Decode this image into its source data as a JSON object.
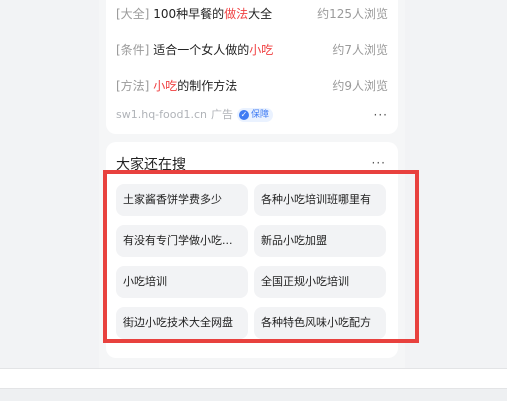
{
  "ad_card": {
    "rows": [
      {
        "tag": "[大全]",
        "pre": "100种早餐的",
        "highlight": "做法",
        "post": "大全",
        "views": "约125人浏览"
      },
      {
        "tag": "[条件]",
        "pre": "适合一个女人做的",
        "highlight": "小吃",
        "post": "",
        "views": "约7人浏览"
      },
      {
        "tag": "[方法]",
        "pre": "",
        "highlight": "小吃",
        "post": "的制作方法",
        "views": "约9人浏览"
      }
    ],
    "source_domain": "sw1.hq-food1.cn",
    "ad_label": "广告",
    "badge_label": "保障",
    "more_glyph": "···"
  },
  "people_search": {
    "title": "大家还在搜",
    "more_glyph": "···",
    "items": [
      "土家酱香饼学费多少",
      "各种小吃培训班哪里有",
      "有没有专门学做小吃...",
      "新品小吃加盟",
      "小吃培训",
      "全国正规小吃培训",
      "街边小吃技术大全网盘",
      "各种特色风味小吃配方"
    ]
  },
  "colors": {
    "highlight": "#f04142",
    "annotation_box": "#e8413e",
    "badge": "#3f7bf3"
  }
}
